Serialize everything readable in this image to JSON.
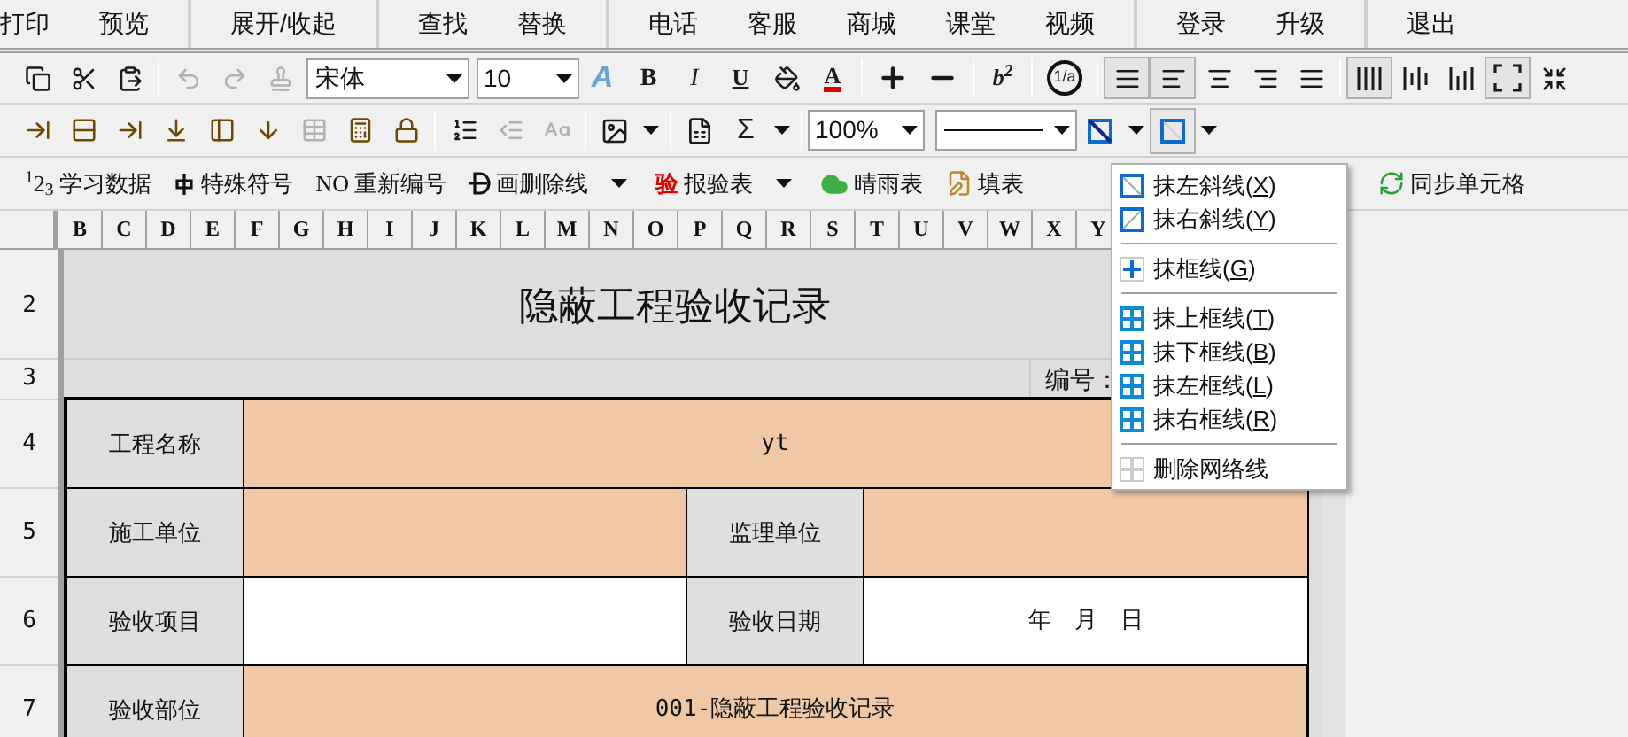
{
  "menu_bar": {
    "groups": [
      {
        "items": [
          "打印",
          "预览"
        ]
      },
      {
        "items": [
          "展开/收起"
        ]
      },
      {
        "items": [
          "查找",
          "替换"
        ]
      },
      {
        "items": [
          "电话",
          "客服",
          "商城",
          "课堂",
          "视频"
        ]
      },
      {
        "items": [
          "登录",
          "升级"
        ]
      },
      {
        "items": [
          "退出"
        ]
      }
    ]
  },
  "toolbar_1": {
    "edit_buttons": [
      {
        "disabled": false
      },
      {
        "disabled": false
      },
      {
        "disabled": false
      },
      {
        "disabled": true
      },
      {
        "disabled": true
      },
      {
        "disabled": true
      }
    ],
    "font": "宋体",
    "font_size": "10",
    "wordart": "A",
    "bold": "B",
    "italic": "I",
    "underline": "U",
    "font_color": "A",
    "superscript": "b$^{2}$",
    "fraction": "1/a",
    "align_buttons": [
      {
        "selected": true
      },
      {
        "selected": true
      },
      {
        "selected": false
      },
      {
        "selected": false
      },
      {
        "selected": false
      }
    ],
    "valign_buttons": [
      {
        "selected": true
      },
      {
        "selected": false
      },
      {
        "selected": false
      }
    ],
    "fit_selected": true
  },
  "toolbar_2": {
    "table_buttons": [
      {
        "disabled": false
      },
      {
        "disabled": false
      },
      {
        "disabled": false
      },
      {
        "disabled": false
      },
      {
        "disabled": false
      },
      {
        "disabled": false
      },
      {
        "disabled": true
      },
      {
        "disabled": false
      },
      {
        "disabled": false
      }
    ],
    "format_buttons": [
      {
        "disabled": false
      },
      {
        "disabled": true
      },
      {
        "disabled": true
      }
    ],
    "sigma": "Σ",
    "zoom": "100%",
    "border_selected": true
  },
  "toolbar_3": {
    "buttons": [
      {
        "icon_text": "$^{1}$2$_{3}$",
        "label": "学习数据",
        "dropdown": false
      },
      {
        "label": "特殊符号",
        "dropdown": false
      },
      {
        "icon_text": "NO",
        "label": "重新编号",
        "dropdown": false
      },
      {
        "label": "画删除线",
        "dropdown": true
      },
      {
        "icon_text": "验",
        "label": "报验表",
        "dropdown": true
      },
      {
        "label": "晴雨表",
        "dropdown": false
      },
      {
        "label": "填表",
        "dropdown": false
      },
      {
        "label": "同步单元格",
        "dropdown": false
      }
    ]
  },
  "sheet": {
    "columns": [
      "B",
      "C",
      "D",
      "E",
      "F",
      "G",
      "H",
      "I",
      "J",
      "K",
      "L",
      "M",
      "N",
      "O",
      "P",
      "Q",
      "R",
      "S",
      "T",
      "U",
      "V",
      "W",
      "X",
      "Y"
    ],
    "row_numbers": [
      "2",
      "3",
      "4",
      "5",
      "6",
      "7"
    ],
    "title": "隐蔽工程验收记录",
    "number_label": "编号：",
    "form": [
      {
        "cells": [
          {
            "kind": "label",
            "text": "工程名称"
          },
          {
            "kind": "wide",
            "text": "yt",
            "color": "#f0c8a6"
          }
        ]
      },
      {
        "cells": [
          {
            "kind": "label",
            "text": "施工单位"
          },
          {
            "kind": "value",
            "color": "#f0c8a6"
          },
          {
            "kind": "label",
            "text": "监理单位"
          },
          {
            "kind": "value",
            "color": "#f0c8a6"
          }
        ]
      },
      {
        "cells": [
          {
            "kind": "label",
            "text": "验收项目"
          },
          {
            "kind": "value",
            "color": "#ffffff"
          },
          {
            "kind": "label",
            "text": "验收日期"
          },
          {
            "kind": "value",
            "text": "年　月　日",
            "color": "#ffffff"
          }
        ]
      },
      {
        "cells": [
          {
            "kind": "label",
            "text": "验收部位"
          },
          {
            "kind": "wide",
            "text": "001-隐蔽工程验收记录",
            "color": "#f0c8a6"
          }
        ]
      }
    ]
  },
  "context_menu": {
    "items": [
      {
        "kind": "item",
        "text": "抹左斜线(",
        "key": "X",
        "end": ")"
      },
      {
        "kind": "item",
        "text": "抹右斜线(",
        "key": "Y",
        "end": ")"
      },
      {
        "kind": "separator"
      },
      {
        "kind": "item",
        "text": "抹框线(",
        "key": "G",
        "end": ")"
      },
      {
        "kind": "separator"
      },
      {
        "kind": "item",
        "text": "抹上框线(",
        "key": "T",
        "end": ")"
      },
      {
        "kind": "item",
        "text": "抹下框线(",
        "key": "B",
        "end": ")"
      },
      {
        "kind": "item",
        "text": "抹左框线(",
        "key": "L",
        "end": ")"
      },
      {
        "kind": "item",
        "text": "抹右框线(",
        "key": "R",
        "end": ")"
      },
      {
        "kind": "separator"
      },
      {
        "kind": "item",
        "text": "删除网络线"
      }
    ]
  }
}
